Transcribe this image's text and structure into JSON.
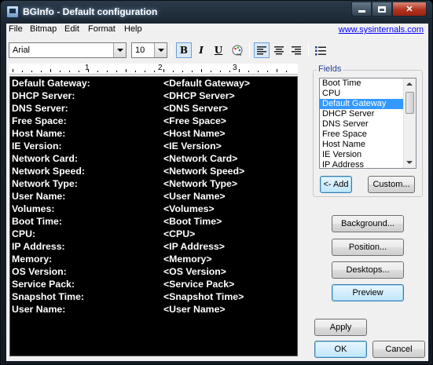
{
  "window": {
    "title": "BGInfo - Default configuration"
  },
  "menu": {
    "items": [
      "File",
      "Bitmap",
      "Edit",
      "Format",
      "Help"
    ],
    "link": "www.sysinternals.com"
  },
  "toolbar": {
    "font": "Arial",
    "size": "10",
    "bold": "B",
    "italic": "I",
    "underline": "U",
    "active_buttons": [
      "bold",
      "align-left"
    ]
  },
  "ruler": {
    "labels": [
      "1",
      "2",
      "3"
    ]
  },
  "editor": {
    "rows": [
      {
        "label": "Default Gateway:",
        "tag": "<Default Gateway>"
      },
      {
        "label": "DHCP Server:",
        "tag": "<DHCP Server>"
      },
      {
        "label": "DNS Server:",
        "tag": "<DNS Server>"
      },
      {
        "label": "Free Space:",
        "tag": "<Free Space>"
      },
      {
        "label": "Host Name:",
        "tag": "<Host Name>"
      },
      {
        "label": "IE Version:",
        "tag": "<IE Version>"
      },
      {
        "label": "Network Card:",
        "tag": "<Network Card>"
      },
      {
        "label": "Network Speed:",
        "tag": "<Network Speed>"
      },
      {
        "label": "Network Type:",
        "tag": "<Network Type>"
      },
      {
        "label": "User Name:",
        "tag": "<User Name>"
      },
      {
        "label": "Volumes:",
        "tag": "<Volumes>"
      },
      {
        "label": "Boot Time:",
        "tag": "<Boot Time>"
      },
      {
        "label": "CPU:",
        "tag": "<CPU>"
      },
      {
        "label": "IP Address:",
        "tag": "<IP Address>"
      },
      {
        "label": "Memory:",
        "tag": "<Memory>"
      },
      {
        "label": "OS Version:",
        "tag": "<OS Version>"
      },
      {
        "label": "Service Pack:",
        "tag": "<Service Pack>"
      },
      {
        "label": "Snapshot Time:",
        "tag": "<Snapshot Time>"
      },
      {
        "label": "User Name:",
        "tag": "<User Name>"
      }
    ]
  },
  "fields": {
    "title": "Fields",
    "items": [
      "Boot Time",
      "CPU",
      "Default Gateway",
      "DHCP Server",
      "DNS Server",
      "Free Space",
      "Host Name",
      "IE Version",
      "IP Address"
    ],
    "selected": "Default Gateway",
    "add_label": "<- Add",
    "custom_label": "Custom..."
  },
  "buttons": {
    "background": "Background...",
    "position": "Position...",
    "desktops": "Desktops...",
    "preview": "Preview",
    "apply": "Apply",
    "ok": "OK",
    "cancel": "Cancel"
  },
  "colors": {
    "selection": "#3399ff",
    "link": "#0000ff",
    "fields_title": "#1e3f91",
    "editor_bg": "#000000",
    "editor_text": "#ffffff"
  }
}
